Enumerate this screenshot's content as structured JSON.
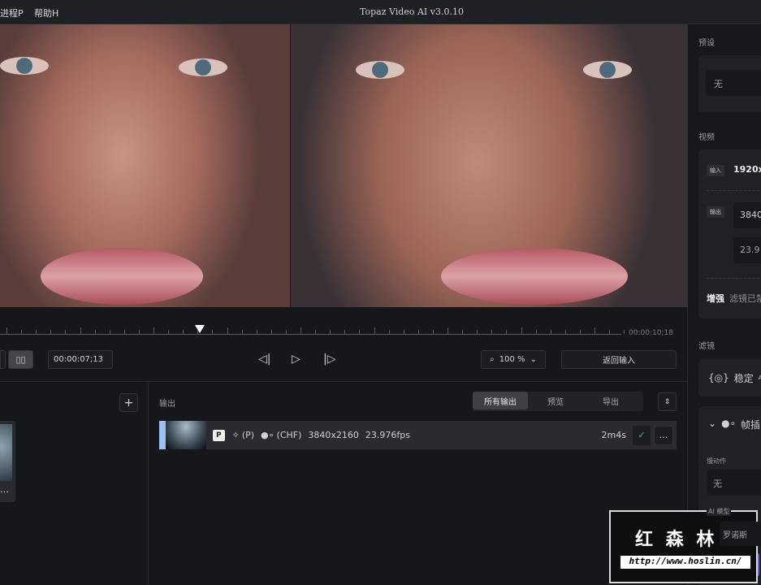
{
  "menu": [
    "进程P",
    "帮助H"
  ],
  "title": "Topaz Video AI  v3.0.10",
  "timeline": {
    "end_time": "00:00:10;18",
    "current_time": "00:00:07;13",
    "playhead_fraction": 0.31
  },
  "toolbar": {
    "zoom": "100 %",
    "return_input": "返回输入"
  },
  "output": {
    "heading": "输出",
    "tabs": [
      "所有输出",
      "预览",
      "导出"
    ],
    "active_tab": 0,
    "row": {
      "badge": "P",
      "model": "(P)",
      "interp": "(CHF)",
      "resolution": "3840x2160",
      "fps": "23.976fps",
      "duration": "2m4s"
    }
  },
  "sidebar": {
    "preset_label": "预设",
    "preset_value": "无",
    "video_label": "视频",
    "input_tag": "输入",
    "input_value": "1920x",
    "output_tag": "输出",
    "output_res": "3840",
    "output_fps": "23.9",
    "enhance": "增强",
    "enhance_text": "滤镜已禁",
    "filters_label": "滤镜",
    "stabilize": "稳定",
    "ai_sup": "AI",
    "frame_interp": "帧插",
    "slowmo_label": "慢动作",
    "slowmo_value": "无",
    "ai_model_label": "AI 模型",
    "ai_model_value": "罗诺斯"
  },
  "watermark": {
    "name": "红 森 林",
    "url": "http://www.hoslin.cn/"
  }
}
